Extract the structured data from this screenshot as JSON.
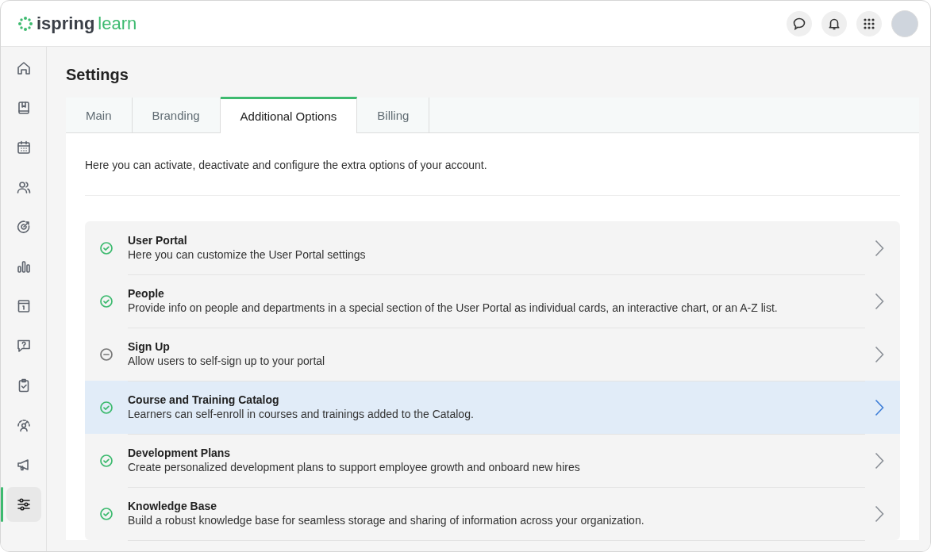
{
  "header": {
    "logo_word_1": "ispring",
    "logo_word_2": "learn"
  },
  "sidebar": {
    "items": [
      {
        "kind": "home",
        "selected": false
      },
      {
        "kind": "book",
        "selected": false
      },
      {
        "kind": "calendar",
        "selected": false
      },
      {
        "kind": "users",
        "selected": false
      },
      {
        "kind": "target",
        "selected": false
      },
      {
        "kind": "chart",
        "selected": false
      },
      {
        "kind": "info",
        "selected": false
      },
      {
        "kind": "question",
        "selected": false
      },
      {
        "kind": "clipboard",
        "selected": false
      },
      {
        "kind": "gauge",
        "selected": false
      },
      {
        "kind": "megaphone",
        "selected": false
      },
      {
        "kind": "sliders",
        "selected": true
      }
    ]
  },
  "page": {
    "title": "Settings"
  },
  "tabs": [
    {
      "label": "Main",
      "selected": false
    },
    {
      "label": "Branding",
      "selected": false
    },
    {
      "label": "Additional Options",
      "selected": true
    },
    {
      "label": "Billing",
      "selected": false
    }
  ],
  "intro": "Here you can activate, deactivate and configure the extra options of your account.",
  "options": [
    {
      "title": "User Portal",
      "description": "Here you can customize the User Portal settings",
      "on": true,
      "selected": false
    },
    {
      "title": "People",
      "description": "Provide info on people and departments in a special section of the User Portal as individual cards, an interactive chart, or an A-Z list.",
      "on": true,
      "selected": false
    },
    {
      "title": "Sign Up",
      "description": "Allow users to self-sign up to your portal",
      "on": false,
      "selected": false
    },
    {
      "title": "Course and Training Catalog",
      "description": "Learners can self-enroll in courses and trainings added to the Catalog.",
      "on": true,
      "selected": true
    },
    {
      "title": "Development Plans",
      "description": "Create personalized development plans to support employee growth and onboard new hires",
      "on": true,
      "selected": false
    },
    {
      "title": "Knowledge Base",
      "description": "Build a robust knowledge base for seamless storage and sharing of information across your organization.",
      "on": true,
      "selected": false
    }
  ]
}
